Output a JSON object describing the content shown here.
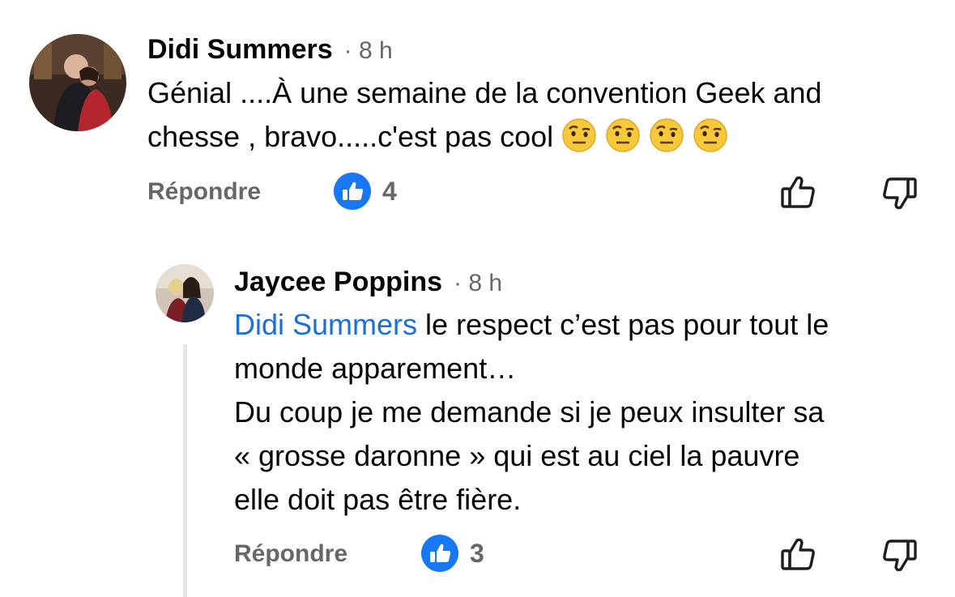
{
  "comment": {
    "author": "Didi Summers",
    "meta": "· 8 h",
    "line1": "Génial ....À une semaine de la convention Geek and",
    "line2": "chesse , bravo.....c'est pas cool",
    "emojis": [
      "face-with-raised-eyebrow",
      "face-with-raised-eyebrow",
      "face-with-raised-eyebrow",
      "face-with-raised-eyebrow"
    ],
    "reply_label": "Répondre",
    "like_count": "4"
  },
  "reply": {
    "author": "Jaycee Poppins",
    "meta": "· 8 h",
    "mention": "Didi Summers",
    "line1_rest": " le respect c’est pas pour tout le",
    "line2": "monde apparement…",
    "line3": "Du coup je me demande si je peux insulter sa",
    "line4": "« grosse daronne » qui est au ciel la pauvre",
    "line5": "elle doit pas être fière.",
    "reply_label": "Répondre",
    "like_count": "3"
  },
  "colors": {
    "like_blue": "#1877f2",
    "mention_blue": "#1b6fd8",
    "secondary_text": "#65676b"
  }
}
